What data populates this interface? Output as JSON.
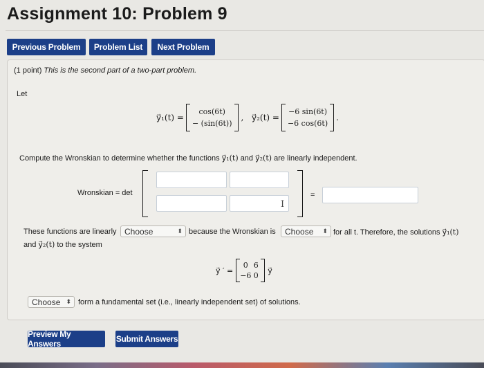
{
  "page_title": "Assignment 10: Problem 9",
  "nav": {
    "previous": "Previous Problem",
    "list": "Problem List",
    "next": "Next Problem"
  },
  "problem": {
    "points": "(1 point)",
    "intro": "This is the second part of a two-part problem.",
    "let": "Let",
    "y1_label": "y⃗₁(t) =",
    "y1_top": "cos(6t)",
    "y1_bottom": "− (sin(6t))",
    "y2_label": "y⃗₂(t) =",
    "y2_top": "−6 sin(6t)",
    "y2_bottom": "−6 cos(6t)",
    "compute_text_a": "Compute the Wronskian to determine whether the functions",
    "compute_y1": "y⃗₁(t)",
    "compute_and": "and",
    "compute_y2": "y⃗₂(t)",
    "compute_text_b": "are linearly independent.",
    "wronskian_label": "Wronskian = det",
    "equals": "=",
    "sentence_a": "These functions are linearly",
    "select1": "Choose",
    "sentence_b": "because the Wronskian is",
    "select2": "Choose",
    "sentence_c": "for all t. Therefore, the solutions",
    "sentence_y1": "y⃗₁(t)",
    "sentence_and": "and",
    "sentence_y2": "y⃗₂(t)",
    "sentence_d": "to the system",
    "system_lhs": "y⃗ ′ =",
    "matrix": [
      "0",
      "6",
      "−6",
      "0"
    ],
    "system_rhs": "y⃗",
    "select3": "Choose",
    "fundamental_text": "form a fundamental set (i.e., linearly independent set) of solutions."
  },
  "actions": {
    "preview": "Preview My Answers",
    "submit": "Submit Answers"
  }
}
